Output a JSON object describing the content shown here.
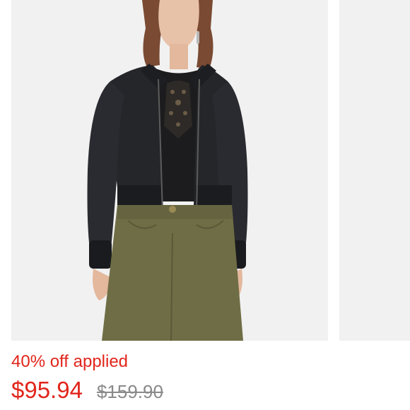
{
  "product": {
    "image_description_icon": "product-photo",
    "promo_text": "40% off applied",
    "price_current": "$95.94",
    "price_original": "$159.90"
  },
  "colors": {
    "sale_red": "#e1251b",
    "strike_gray": "#8a8a8a",
    "card_bg": "#f1f1f1"
  }
}
